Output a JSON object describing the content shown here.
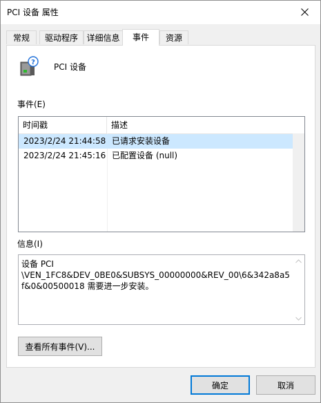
{
  "window": {
    "title": "PCI 设备 属性"
  },
  "tabs": [
    {
      "label": "常规",
      "active": false
    },
    {
      "label": "驱动程序",
      "active": false
    },
    {
      "label": "详细信息",
      "active": false
    },
    {
      "label": "事件",
      "active": true
    },
    {
      "label": "资源",
      "active": false
    }
  ],
  "device": {
    "name": "PCI 设备",
    "icon": "unknown-device-icon"
  },
  "events": {
    "label": "事件(E)",
    "columns": [
      "时间戳",
      "描述"
    ],
    "rows": [
      {
        "timestamp": "2023/2/24 21:44:58",
        "description": "已请求安装设备",
        "selected": true
      },
      {
        "timestamp": "2023/2/24 21:45:16",
        "description": "已配置设备 (null)",
        "selected": false
      }
    ]
  },
  "info": {
    "label": "信息(I)",
    "text": "设备 PCI\n\\VEN_1FC8&DEV_0BE0&SUBSYS_00000000&REV_00\\6&342a8a5f&0&00500018 需要进一步安装。"
  },
  "buttons": {
    "view_all_events": "查看所有事件(V)...",
    "ok": "确定",
    "cancel": "取消"
  },
  "colors": {
    "selection": "#cce8ff",
    "accent": "#0078d7",
    "dialog_bg": "#f0f0f0"
  }
}
